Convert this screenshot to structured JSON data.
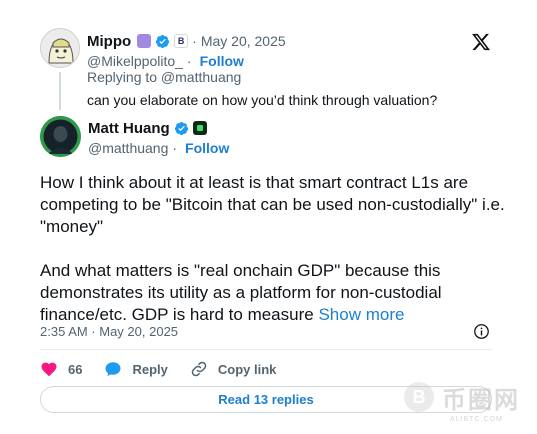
{
  "parent_tweet": {
    "name": "Mippo",
    "date": "May 20, 2025",
    "handle": "@Mikelppolito_",
    "follow_label": "Follow",
    "separator": "·",
    "badge_letter": "B",
    "replying_to": "Replying to @matthuang",
    "text": "can you elaborate on how you’d think through valuation?"
  },
  "main_tweet": {
    "name": "Matt Huang",
    "handle": "@matthuang",
    "follow_label": "Follow",
    "separator": "·",
    "paragraph1": "How I think about it at least is that smart contract L1s are competing to be \"Bitcoin that can be used non-custodially\" i.e. \"money\"",
    "paragraph2": "And what matters is \"real onchain GDP\" because this demonstrates its utility as a platform for non-custodial finance/etc. GDP is hard to measure",
    "show_more": "Show more",
    "timestamp": "2:35 AM · May 20, 2025"
  },
  "actions": {
    "like_count": "66",
    "reply_label": "Reply",
    "copy_label": "Copy link"
  },
  "read_replies_label": "Read 13 replies",
  "watermark": {
    "coin": "B",
    "text": "币圈网",
    "sub": "ALIBTC.COM"
  },
  "colors": {
    "accent": "#1d7fd0",
    "verified": "#1d9bf0",
    "like": "#f91880",
    "muted": "#536471"
  }
}
